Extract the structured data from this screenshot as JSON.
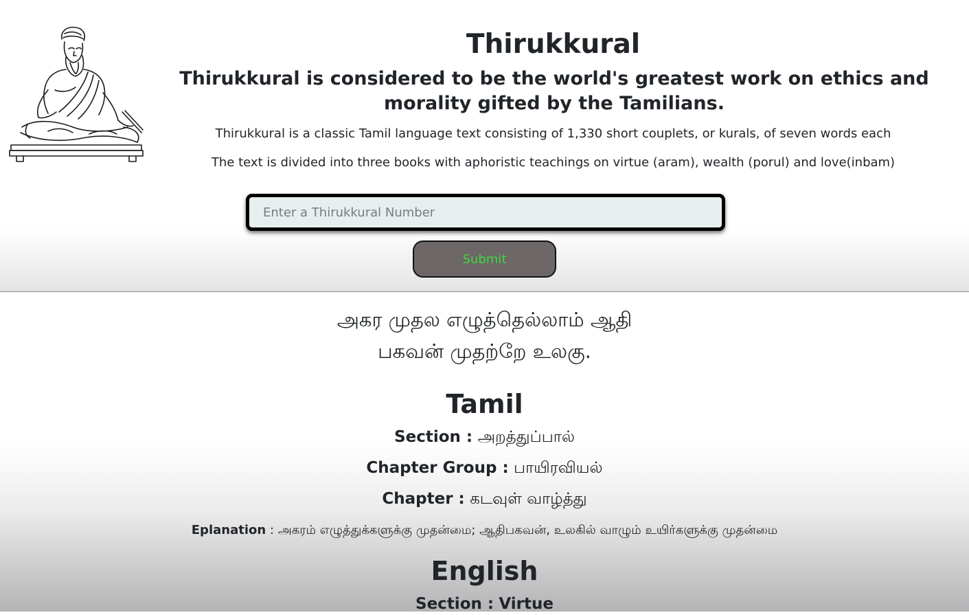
{
  "header": {
    "title": "Thirukkural",
    "tagline": "Thirukkural is considered to be the world's greatest work on ethics and morality gifted by the Tamilians.",
    "description_1": "Thirukkural is a classic Tamil language text consisting of 1,330 short couplets, or kurals, of seven words each",
    "description_2": "The text is divided into three books with aphoristic teachings on virtue (aram), wealth (porul) and love(inbam)"
  },
  "search": {
    "placeholder": "Enter a Thirukkural Number",
    "value": "",
    "submit_label": "Submit"
  },
  "colors": {
    "submit_bg": "#6e6767",
    "submit_text": "#3fd83f",
    "input_bg": "#e8edef"
  },
  "result": {
    "couplet_line_1": "அகர முதல எழுத்தெல்லாம் ஆதி",
    "couplet_line_2": "பகவன் முதற்றே உலகு.",
    "tamil": {
      "heading": "Tamil",
      "section_label": "Section :",
      "section_value": "அறத்துப்பால்",
      "chapter_group_label": "Chapter Group :",
      "chapter_group_value": "பாயிரவியல்",
      "chapter_label": "Chapter :",
      "chapter_value": "கடவுள் வாழ்த்து",
      "explanation_label": "Eplanation",
      "explanation_value": ": அகரம் எழுத்துக்களுக்கு முதன்மை; ஆதிபகவன், உலகில் வாழும் உயிர்களுக்கு முதன்மை"
    },
    "english": {
      "heading": "English",
      "section_label": "Section :",
      "section_value": "Virtue"
    }
  }
}
